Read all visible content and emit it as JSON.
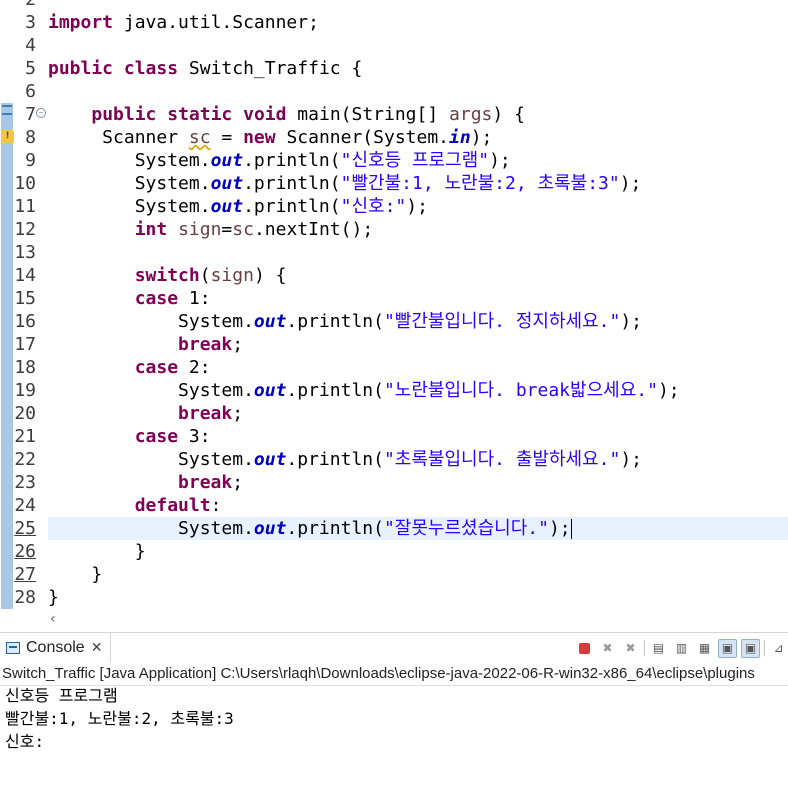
{
  "editor": {
    "lines": [
      {
        "num": "2",
        "segments": []
      },
      {
        "num": "3",
        "segments": [
          {
            "t": "import",
            "c": "kw"
          },
          {
            "t": " java.util.Scanner;",
            "c": ""
          }
        ]
      },
      {
        "num": "4",
        "segments": []
      },
      {
        "num": "5",
        "segments": [
          {
            "t": "public",
            "c": "kw"
          },
          {
            "t": " ",
            "c": ""
          },
          {
            "t": "class",
            "c": "kw"
          },
          {
            "t": " Switch_Traffic {",
            "c": ""
          }
        ]
      },
      {
        "num": "6",
        "segments": []
      },
      {
        "num": "7",
        "fold": true,
        "segments": [
          {
            "t": "    ",
            "c": ""
          },
          {
            "t": "public",
            "c": "kw"
          },
          {
            "t": " ",
            "c": ""
          },
          {
            "t": "static",
            "c": "kw"
          },
          {
            "t": " ",
            "c": ""
          },
          {
            "t": "void",
            "c": "kw"
          },
          {
            "t": " main(String[] ",
            "c": ""
          },
          {
            "t": "args",
            "c": "var"
          },
          {
            "t": ") {",
            "c": ""
          }
        ]
      },
      {
        "num": "8",
        "warn": true,
        "segments": [
          {
            "t": "     Scanner ",
            "c": ""
          },
          {
            "t": "sc",
            "c": "var sc-warn"
          },
          {
            "t": " = ",
            "c": ""
          },
          {
            "t": "new",
            "c": "kw"
          },
          {
            "t": " Scanner(System.",
            "c": ""
          },
          {
            "t": "in",
            "c": "fld"
          },
          {
            "t": ");",
            "c": ""
          }
        ]
      },
      {
        "num": "9",
        "segments": [
          {
            "t": "        System.",
            "c": ""
          },
          {
            "t": "out",
            "c": "fld"
          },
          {
            "t": ".println(",
            "c": ""
          },
          {
            "t": "\"신호등 프로그램\"",
            "c": "str"
          },
          {
            "t": ");",
            "c": ""
          }
        ]
      },
      {
        "num": "10",
        "segments": [
          {
            "t": "        System.",
            "c": ""
          },
          {
            "t": "out",
            "c": "fld"
          },
          {
            "t": ".println(",
            "c": ""
          },
          {
            "t": "\"빨간불:1, 노란불:2, 초록불:3\"",
            "c": "str"
          },
          {
            "t": ");",
            "c": ""
          }
        ]
      },
      {
        "num": "11",
        "segments": [
          {
            "t": "        System.",
            "c": ""
          },
          {
            "t": "out",
            "c": "fld"
          },
          {
            "t": ".println(",
            "c": ""
          },
          {
            "t": "\"신호:\"",
            "c": "str"
          },
          {
            "t": ");",
            "c": ""
          }
        ]
      },
      {
        "num": "12",
        "segments": [
          {
            "t": "        ",
            "c": ""
          },
          {
            "t": "int",
            "c": "kw"
          },
          {
            "t": " ",
            "c": ""
          },
          {
            "t": "sign",
            "c": "var"
          },
          {
            "t": "=",
            "c": ""
          },
          {
            "t": "sc",
            "c": "var"
          },
          {
            "t": ".nextInt();",
            "c": ""
          }
        ]
      },
      {
        "num": "13",
        "segments": []
      },
      {
        "num": "14",
        "segments": [
          {
            "t": "        ",
            "c": ""
          },
          {
            "t": "switch",
            "c": "kw"
          },
          {
            "t": "(",
            "c": ""
          },
          {
            "t": "sign",
            "c": "var"
          },
          {
            "t": ") {",
            "c": ""
          }
        ]
      },
      {
        "num": "15",
        "segments": [
          {
            "t": "        ",
            "c": ""
          },
          {
            "t": "case",
            "c": "kw"
          },
          {
            "t": " 1:",
            "c": ""
          }
        ]
      },
      {
        "num": "16",
        "segments": [
          {
            "t": "            System.",
            "c": ""
          },
          {
            "t": "out",
            "c": "fld"
          },
          {
            "t": ".println(",
            "c": ""
          },
          {
            "t": "\"빨간불입니다. 정지하세요.\"",
            "c": "str"
          },
          {
            "t": ");",
            "c": ""
          }
        ]
      },
      {
        "num": "17",
        "segments": [
          {
            "t": "            ",
            "c": ""
          },
          {
            "t": "break",
            "c": "kw"
          },
          {
            "t": ";",
            "c": ""
          }
        ]
      },
      {
        "num": "18",
        "segments": [
          {
            "t": "        ",
            "c": ""
          },
          {
            "t": "case",
            "c": "kw"
          },
          {
            "t": " 2:",
            "c": ""
          }
        ]
      },
      {
        "num": "19",
        "segments": [
          {
            "t": "            System.",
            "c": ""
          },
          {
            "t": "out",
            "c": "fld"
          },
          {
            "t": ".println(",
            "c": ""
          },
          {
            "t": "\"노란불입니다. break밟으세요.\"",
            "c": "str"
          },
          {
            "t": ");",
            "c": ""
          }
        ]
      },
      {
        "num": "20",
        "segments": [
          {
            "t": "            ",
            "c": ""
          },
          {
            "t": "break",
            "c": "kw"
          },
          {
            "t": ";",
            "c": ""
          }
        ]
      },
      {
        "num": "21",
        "segments": [
          {
            "t": "        ",
            "c": ""
          },
          {
            "t": "case",
            "c": "kw"
          },
          {
            "t": " 3:",
            "c": ""
          }
        ]
      },
      {
        "num": "22",
        "segments": [
          {
            "t": "            System.",
            "c": ""
          },
          {
            "t": "out",
            "c": "fld"
          },
          {
            "t": ".println(",
            "c": ""
          },
          {
            "t": "\"초록불입니다. 출발하세요.\"",
            "c": "str"
          },
          {
            "t": ");",
            "c": ""
          }
        ]
      },
      {
        "num": "23",
        "segments": [
          {
            "t": "            ",
            "c": ""
          },
          {
            "t": "break",
            "c": "kw"
          },
          {
            "t": ";",
            "c": ""
          }
        ]
      },
      {
        "num": "24",
        "segments": [
          {
            "t": "        ",
            "c": ""
          },
          {
            "t": "default",
            "c": "kw"
          },
          {
            "t": ":",
            "c": ""
          }
        ]
      },
      {
        "num": "25",
        "current": true,
        "underline": true,
        "segments": [
          {
            "t": "            System.",
            "c": ""
          },
          {
            "t": "out",
            "c": "fld"
          },
          {
            "t": ".println(",
            "c": ""
          },
          {
            "t": "\"잘못누르셨습니다.\"",
            "c": "str"
          },
          {
            "t": ");",
            "c": ""
          }
        ]
      },
      {
        "num": "26",
        "underline": true,
        "segments": [
          {
            "t": "        }",
            "c": ""
          }
        ]
      },
      {
        "num": "27",
        "underline": true,
        "segments": [
          {
            "t": "    }",
            "c": ""
          }
        ]
      },
      {
        "num": "28",
        "segments": [
          {
            "t": "}",
            "c": ""
          }
        ]
      }
    ],
    "scroll_left_icon": "chevron-left-icon"
  },
  "console": {
    "tab_label": "Console",
    "tab_icon": "console-icon",
    "close_glyph": "✕",
    "description": "Switch_Traffic [Java Application] C:\\Users\\rlaqh\\Downloads\\eclipse-java-2022-06-R-win32-x86_64\\eclipse\\plugins",
    "toolbar_icons": [
      "terminate-icon",
      "remove-launch-icon",
      "remove-all-terminated-icon",
      "clear-console-icon",
      "scroll-lock-icon",
      "word-wrap-icon",
      "show-on-stdout-icon",
      "show-on-stderr-icon",
      "pin-console-icon",
      "display-selected-console-icon"
    ],
    "output": [
      "신호등 프로그램",
      "빨간불:1, 노란불:2, 초록불:3",
      "신호:"
    ]
  },
  "colors": {
    "keyword": "#7f0055",
    "string": "#2a00ff",
    "field": "#0000c0",
    "variable": "#6a3e3e",
    "current_line": "#e8f2fe"
  }
}
